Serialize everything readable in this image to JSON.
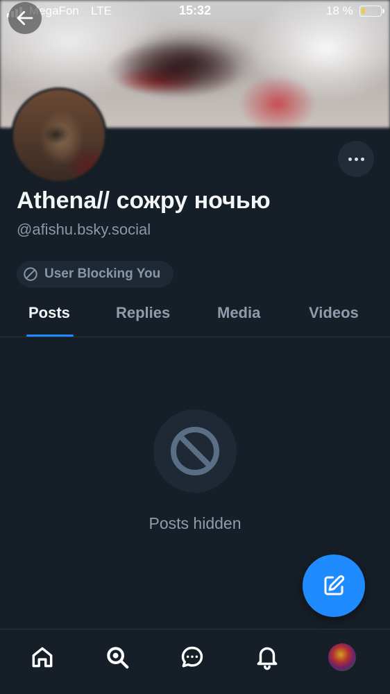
{
  "status_bar": {
    "carrier": "MegaFon",
    "network": "LTE",
    "time": "15:32",
    "battery_percent": "18 %",
    "battery_level": 0.18,
    "battery_color": "#f2c94c"
  },
  "header": {
    "back_icon": "arrow-left-icon",
    "more_icon": "ellipsis-icon"
  },
  "profile": {
    "display_name": "Athena// сожру ночью",
    "handle": "@afishu.bsky.social",
    "blocking_label": "User Blocking You",
    "blocking_icon": "circle-slash-icon"
  },
  "tabs": [
    {
      "label": "Posts",
      "active": true
    },
    {
      "label": "Replies",
      "active": false
    },
    {
      "label": "Media",
      "active": false
    },
    {
      "label": "Videos",
      "active": false
    }
  ],
  "empty_state": {
    "icon": "block-icon",
    "text": "Posts hidden"
  },
  "fab": {
    "icon": "compose-icon"
  },
  "bottom_nav": [
    {
      "icon": "home-icon"
    },
    {
      "icon": "search-icon"
    },
    {
      "icon": "chat-icon"
    },
    {
      "icon": "bell-icon"
    },
    {
      "icon": "profile-avatar"
    }
  ],
  "colors": {
    "background": "#161e27",
    "accent": "#208bfe",
    "muted_text": "#8f9cab"
  }
}
